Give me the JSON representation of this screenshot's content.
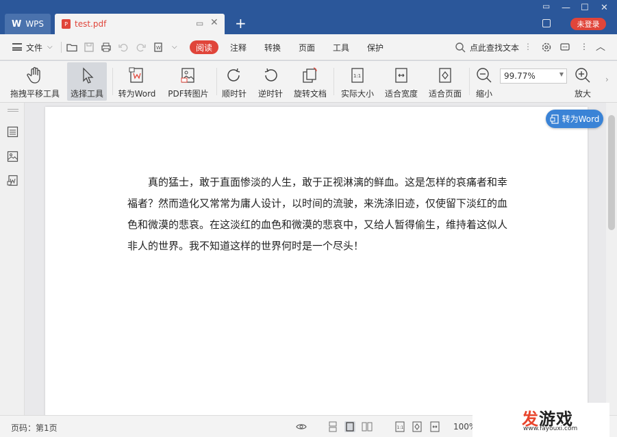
{
  "titlebar": {
    "app_tab": "WPS",
    "doc_tab": "test.pdf",
    "login": "未登录",
    "colors": {
      "bar": "#2b579a",
      "accent_red": "#e0453a"
    }
  },
  "menubar": {
    "file": "文件",
    "read": "阅读",
    "items": [
      "注释",
      "转换",
      "页面",
      "工具",
      "保护"
    ],
    "search": "点此查找文本"
  },
  "toolbar": {
    "hand": "拖拽平移工具",
    "select": "选择工具",
    "to_word": "转为Word",
    "pdf_to_img": "PDF转图片",
    "clockwise": "顺时针",
    "counter": "逆时针",
    "rotate_doc": "旋转文档",
    "actual_size": "实际大小",
    "fit_width": "适合宽度",
    "fit_page": "适合页面",
    "zoom_out": "缩小",
    "zoom_value": "99.77%",
    "zoom_in": "放大",
    "actual_glyph": "1:1"
  },
  "floating": {
    "to_word": "转为Word"
  },
  "document": {
    "paragraph": "真的猛士，敢于直面惨淡的人生，敢于正视淋漓的鲜血。这是怎样的哀痛者和幸福者？然而造化又常常为庸人设计，以时间的流驶，来洗涤旧迹，仅使留下淡红的血色和微漠的悲哀。在这淡红的血色和微漠的悲哀中，又给人暂得偷生，维持着这似人非人的世界。我不知道这样的世界何时是一个尽头！"
  },
  "statusbar": {
    "page": "页码：第1页",
    "zoom": "100%"
  },
  "watermark": {
    "brand_a": "发",
    "brand_b": "游戏",
    "url": "www.fayouxi.com"
  }
}
